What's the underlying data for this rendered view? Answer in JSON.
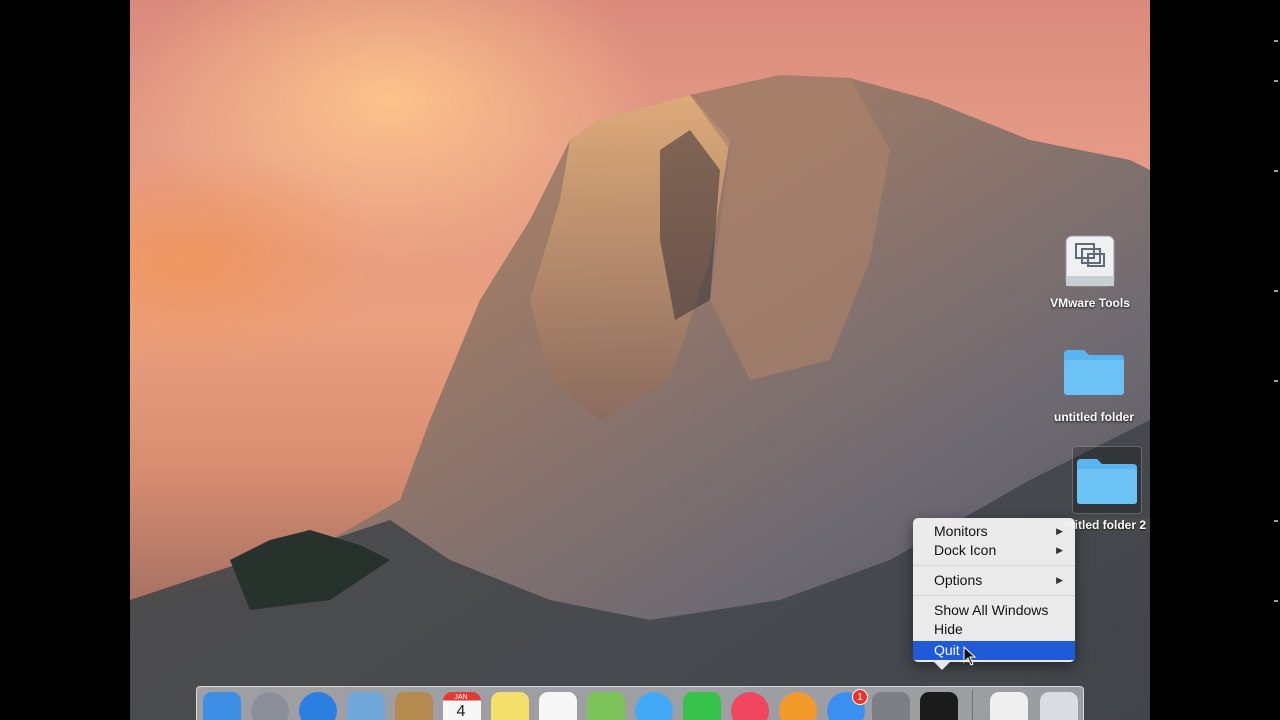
{
  "desktop": {
    "icons": [
      {
        "label": "VMware Tools",
        "icon": "vmware-tools-drive-icon"
      },
      {
        "label": "untitled folder",
        "icon": "folder-icon"
      },
      {
        "label": "untitled folder 2",
        "icon": "folder-icon"
      }
    ]
  },
  "context_menu": {
    "items": [
      {
        "label": "Monitors",
        "submenu": true
      },
      {
        "label": "Dock Icon",
        "submenu": true
      },
      {
        "label": "Options",
        "submenu": true
      },
      {
        "label": "Show All Windows",
        "submenu": false
      },
      {
        "label": "Hide",
        "submenu": false
      },
      {
        "label": "Quit",
        "submenu": false,
        "highlighted": true
      }
    ],
    "submenu_arrow": "▶"
  },
  "dock": {
    "apps": [
      {
        "name": "finder-icon",
        "color": "#3d8fe6"
      },
      {
        "name": "launchpad-icon",
        "color": "#8a8f99"
      },
      {
        "name": "safari-icon",
        "color": "#2a7fe0"
      },
      {
        "name": "photo-slideshow-icon",
        "color": "#6fa8d8"
      },
      {
        "name": "contacts-icon",
        "color": "#b58a4e"
      },
      {
        "name": "calendar-icon",
        "color": "#f5f5f5"
      },
      {
        "name": "notes-icon",
        "color": "#f3df6a"
      },
      {
        "name": "reminders-icon",
        "color": "#f6f6f6"
      },
      {
        "name": "maps-icon",
        "color": "#7cc35a"
      },
      {
        "name": "messages-icon",
        "color": "#41a9f5"
      },
      {
        "name": "facetime-icon",
        "color": "#37c24c"
      },
      {
        "name": "itunes-icon",
        "color": "#f0465e"
      },
      {
        "name": "ibooks-icon",
        "color": "#f39b2a"
      },
      {
        "name": "app-store-icon",
        "color": "#3b8ff0"
      },
      {
        "name": "system-preferences-icon",
        "color": "#7c7f86"
      },
      {
        "name": "activity-monitor-icon",
        "color": "#1b1b1b"
      },
      {
        "name": "documents-stack-icon",
        "color": "#efefef"
      },
      {
        "name": "trash-icon",
        "color": "#d9dde3"
      }
    ],
    "calendar_month": "JAN",
    "calendar_day": "4",
    "app_store_badge": "1"
  }
}
